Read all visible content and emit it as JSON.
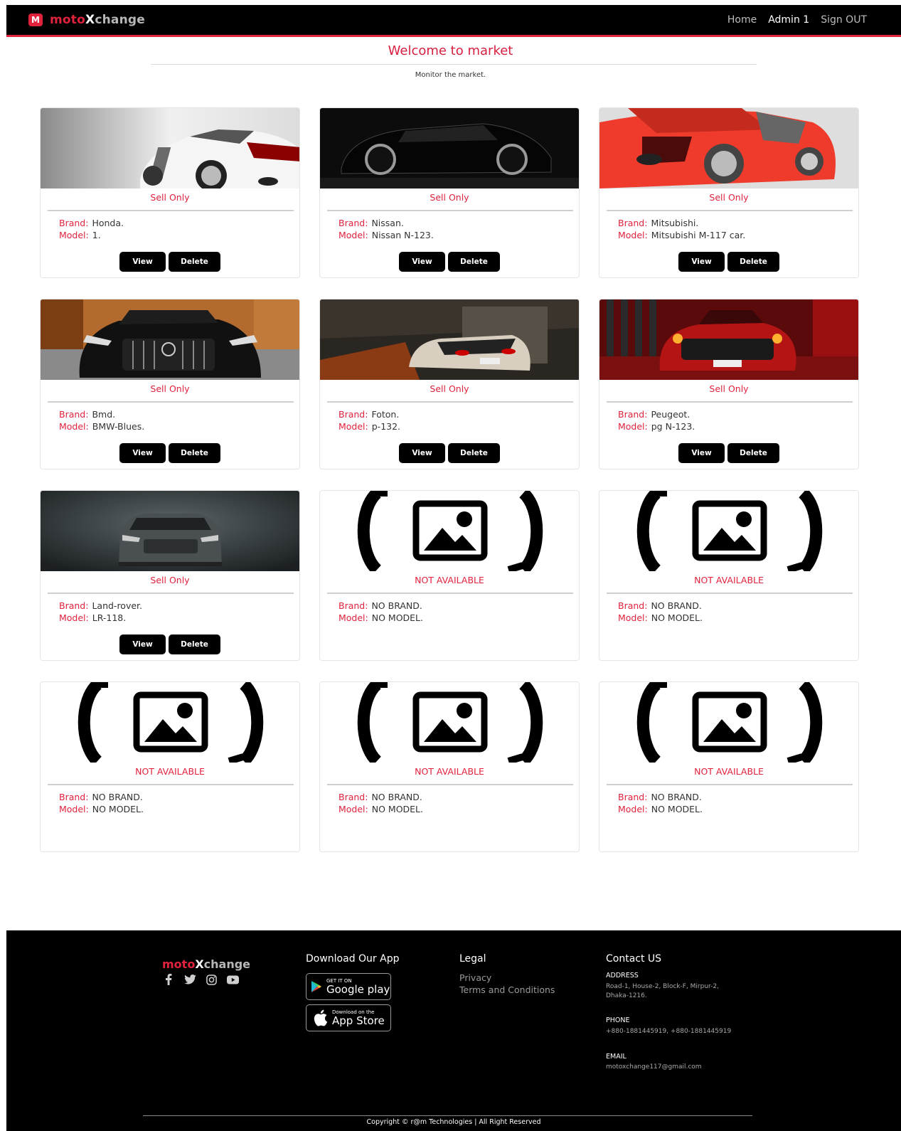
{
  "nav": {
    "logo_part1": "moto",
    "logo_part2": "X",
    "logo_part3": "change",
    "badge": "M",
    "links": [
      "Home",
      "Admin 1",
      "Sign OUT"
    ]
  },
  "header": {
    "title": "Welcome to market",
    "subtitle": "Monitor the market."
  },
  "labels": {
    "brand": "Brand:",
    "model": "Model:",
    "view": "View",
    "delete": "Delete"
  },
  "cards": [
    {
      "tag": "Sell Only",
      "brand": "Honda.",
      "model": "1.",
      "image": "white-sports-car-rear-photo"
    },
    {
      "tag": "Sell Only",
      "brand": "Nissan.",
      "model": "Nissan N-123.",
      "image": "black-sports-car-side-photo"
    },
    {
      "tag": "Sell Only",
      "brand": "Mitsubishi.",
      "model": "Mitsubishi M-117 car.",
      "image": "red-sports-car-rear-photo"
    },
    {
      "tag": "Sell Only",
      "brand": "Bmd.",
      "model": "BMW-Blues.",
      "image": "black-car-front-autumn-photo"
    },
    {
      "tag": "Sell Only",
      "brand": "Foton.",
      "model": "p-132.",
      "image": "white-car-rear-garage-photo"
    },
    {
      "tag": "Sell Only",
      "brand": "Peugeot.",
      "model": "pg N-123.",
      "image": "red-car-rear-neon-photo"
    },
    {
      "tag": "Sell Only",
      "brand": "Land-rover.",
      "model": "LR-118.",
      "image": "grey-suv-front-smoke-photo"
    },
    {
      "tag": "NOT AVAILABLE",
      "brand": "NO BRAND.",
      "model": "NO MODEL.",
      "image": "image-placeholder-icon"
    },
    {
      "tag": "NOT AVAILABLE",
      "brand": "NO BRAND.",
      "model": "NO MODEL.",
      "image": "image-placeholder-icon"
    },
    {
      "tag": "NOT AVAILABLE",
      "brand": "NO BRAND.",
      "model": "NO MODEL.",
      "image": "image-placeholder-icon"
    },
    {
      "tag": "NOT AVAILABLE",
      "brand": "NO BRAND.",
      "model": "NO MODEL.",
      "image": "image-placeholder-icon"
    },
    {
      "tag": "NOT AVAILABLE",
      "brand": "NO BRAND.",
      "model": "NO MODEL.",
      "image": "image-placeholder-icon"
    }
  ],
  "footer": {
    "logo_part1": "moto",
    "logo_part2": "X",
    "logo_part3": "change",
    "social_icons": [
      "facebook-icon",
      "twitter-icon",
      "instagram-icon",
      "youtube-icon"
    ],
    "app_heading": "Download Our App",
    "google_small": "GET IT ON",
    "google_big": "Google play",
    "apple_small": "Download on the",
    "apple_big": "App Store",
    "legal_heading": "Legal",
    "legal_links": [
      "Privacy",
      "Terms and Conditions"
    ],
    "contact_heading": "Contact US",
    "address_label": "ADDRESS",
    "address_line1": "Road-1, House-2, Block-F, Mirpur-2,",
    "address_line2": "Dhaka-1216.",
    "phone_label": "PHONE",
    "phone_value": "+880-1881445919, +880-1881445919",
    "email_label": "EMAIL",
    "email_value": "motoxchange117@gmail.com",
    "copyright": "Copyright © r@m Technologies | All Right Reserved"
  },
  "colors": {
    "accent": "#e0223d",
    "nav_bg": "#000000",
    "footer_bg": "#000000"
  }
}
